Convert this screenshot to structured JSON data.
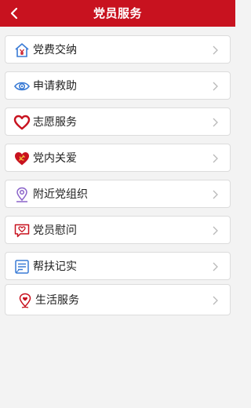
{
  "header": {
    "title": "党员服务",
    "bg_color": "#c8121f",
    "back_icon": "chevron-left-icon"
  },
  "menu": {
    "items": [
      {
        "label": "党费交纳",
        "icon": "house-yuan-icon"
      },
      {
        "label": "申请救助",
        "icon": "eye-swirl-icon"
      },
      {
        "label": "志愿服务",
        "icon": "heart-icon"
      },
      {
        "label": "党内关爱",
        "icon": "heart-party-emblem-icon"
      },
      {
        "label": "附近党组织",
        "icon": "location-pin-icon"
      },
      {
        "label": "党员慰问",
        "icon": "chat-heart-icon"
      },
      {
        "label": "帮扶记实",
        "icon": "document-list-icon"
      },
      {
        "label": "生活服务",
        "icon": "location-heart-icon"
      }
    ],
    "chevron_icon": "chevron-right-icon"
  },
  "colors": {
    "accent_red": "#c8121f",
    "icon_blue": "#3a7bd5",
    "icon_purple": "#8a63c9",
    "background": "#f3f3f3"
  }
}
